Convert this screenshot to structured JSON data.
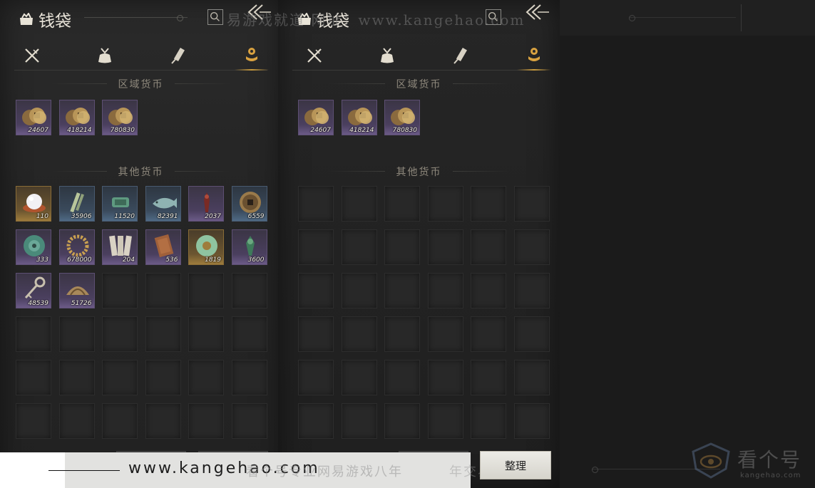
{
  "window_title": "钱袋",
  "tabs": [
    {
      "name": "weapons",
      "icon": "crossed-swords-icon",
      "active": false
    },
    {
      "name": "items",
      "icon": "pouch-icon",
      "active": false
    },
    {
      "name": "scrolls",
      "icon": "scroll-icon",
      "active": false
    },
    {
      "name": "currency",
      "icon": "coin-stack-icon",
      "active": true
    }
  ],
  "sections": {
    "regional": "区域货币",
    "other": "其他货币"
  },
  "left_panel": {
    "regional_items": [
      {
        "icon": "coin-icon",
        "qty": "24607",
        "rarity": "purple"
      },
      {
        "icon": "coin-icon",
        "qty": "418214",
        "rarity": "purple"
      },
      {
        "icon": "coin-icon",
        "qty": "780830",
        "rarity": "purple"
      }
    ],
    "other_items": [
      {
        "icon": "pearl-icon",
        "qty": "110",
        "rarity": "gold"
      },
      {
        "icon": "bamboo-slip-icon",
        "qty": "35906",
        "rarity": "blue"
      },
      {
        "icon": "jade-token-icon",
        "qty": "11520",
        "rarity": "blue"
      },
      {
        "icon": "jade-fish-icon",
        "qty": "82391",
        "rarity": "blue"
      },
      {
        "icon": "red-talisman-icon",
        "qty": "2037",
        "rarity": "purple"
      },
      {
        "icon": "round-coin-icon",
        "qty": "6559",
        "rarity": "blue"
      },
      {
        "icon": "jade-disk-icon",
        "qty": "333",
        "rarity": "purple"
      },
      {
        "icon": "bead-bracelet-icon",
        "qty": "678000",
        "rarity": "purple"
      },
      {
        "icon": "paper-notes-icon",
        "qty": "204",
        "rarity": "purple"
      },
      {
        "icon": "wood-tablet-icon",
        "qty": "536",
        "rarity": "purple"
      },
      {
        "icon": "jade-ring-icon",
        "qty": "1819",
        "rarity": "gold"
      },
      {
        "icon": "green-charm-icon",
        "qty": "3600",
        "rarity": "purple"
      },
      {
        "icon": "key-charm-icon",
        "qty": "48539",
        "rarity": "purple"
      },
      {
        "icon": "shell-coin-icon",
        "qty": "51726",
        "rarity": "purple"
      }
    ]
  },
  "right_panel": {
    "regional_items": [
      {
        "icon": "coin-icon",
        "qty": "24607",
        "rarity": "purple"
      },
      {
        "icon": "coin-icon",
        "qty": "418214",
        "rarity": "purple"
      },
      {
        "icon": "coin-icon",
        "qty": "780830",
        "rarity": "purple"
      }
    ]
  },
  "sort_button": "整理",
  "watermarks": {
    "top": "易游戏就道 网址：www.kangehao.com",
    "url": "www.kangehao.com",
    "slogan": "看个号专业网易游戏八年",
    "slogan2": "年交易额超百亿",
    "logo_main": "看个号",
    "logo_sub": "kangehao.com"
  },
  "colors": {
    "accent_gold": "#c89a3c",
    "rarity_purple": "#6b5a87",
    "rarity_blue": "#4f6a85",
    "rarity_gold": "#9e7c3c"
  }
}
